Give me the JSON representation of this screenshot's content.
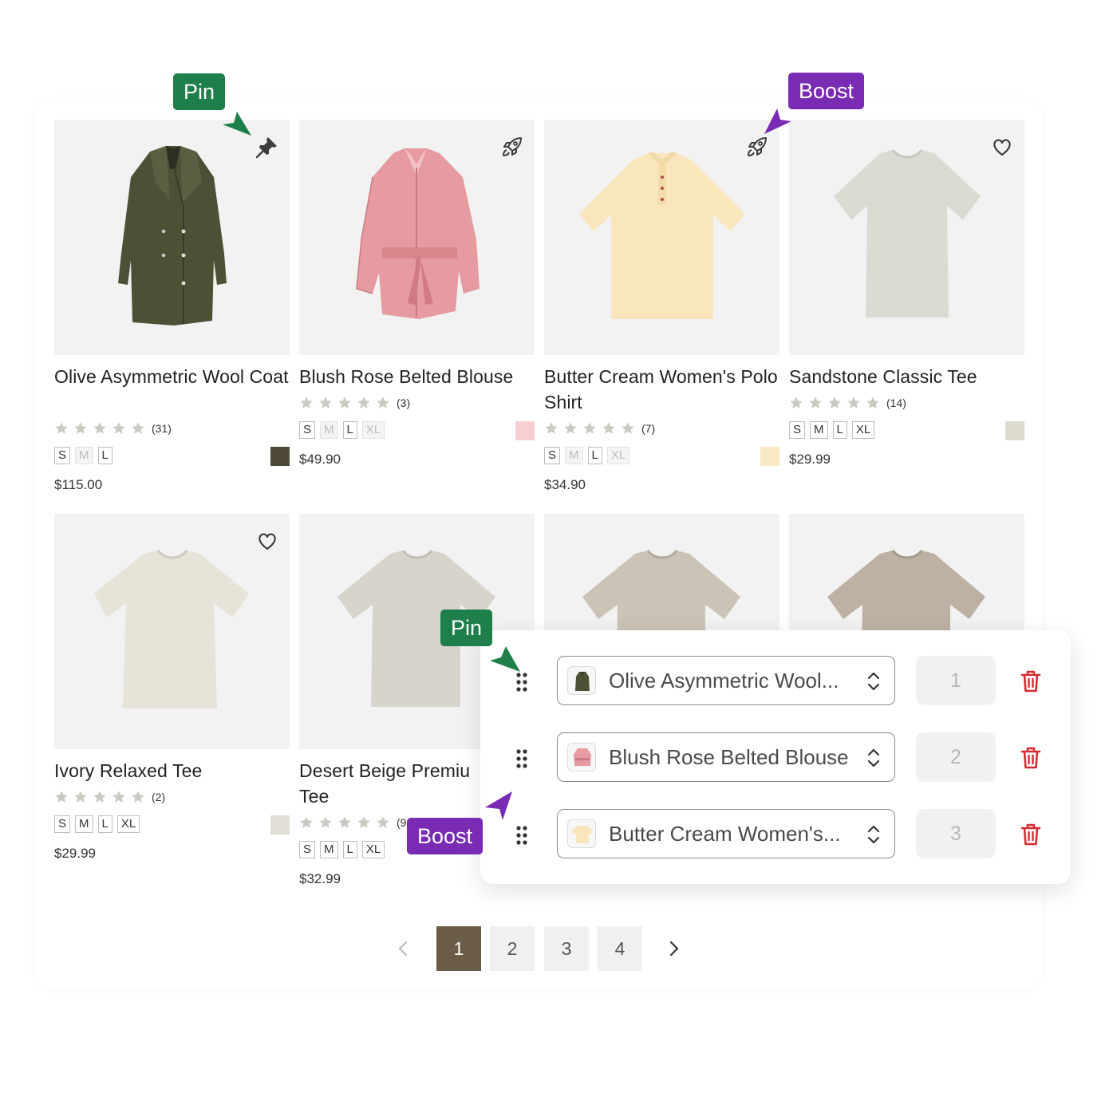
{
  "products": [
    {
      "title": "Olive Asymmetric Wool Coat",
      "reviews": "(31)",
      "sizes": [
        "S",
        "M",
        "L"
      ],
      "dim_sizes": [
        1
      ],
      "swatch": "#4d4838",
      "price": "$115.00",
      "corner_icon": "pin-icon"
    },
    {
      "title": "Blush Rose Belted Blouse",
      "reviews": "(3)",
      "sizes": [
        "S",
        "M",
        "L",
        "XL"
      ],
      "dim_sizes": [
        1,
        3
      ],
      "swatch": "#f7cfd2",
      "price": "$49.90",
      "corner_icon": "rocket-icon"
    },
    {
      "title": "Butter Cream Women's Polo Shirt",
      "reviews": "(7)",
      "sizes": [
        "S",
        "M",
        "L",
        "XL"
      ],
      "dim_sizes": [
        1,
        3
      ],
      "swatch": "#f9e9c2",
      "price": "$34.90",
      "corner_icon": "rocket-icon"
    },
    {
      "title": "Sandstone Classic Tee",
      "reviews": "(14)",
      "sizes": [
        "S",
        "M",
        "L",
        "XL"
      ],
      "dim_sizes": [],
      "swatch": "#dedad0",
      "price": "$29.99",
      "corner_icon": "heart-icon"
    },
    {
      "title": "Ivory Relaxed Tee",
      "reviews": "(2)",
      "sizes": [
        "S",
        "M",
        "L",
        "XL"
      ],
      "dim_sizes": [],
      "swatch": "#e2dfd6",
      "price": "$29.99",
      "corner_icon": "heart-icon"
    },
    {
      "title": "Desert Beige Premiu\nTee",
      "reviews": "(9",
      "sizes": [
        "S",
        "M",
        "L",
        "XL"
      ],
      "dim_sizes": [],
      "price": "$32.99"
    },
    {
      "title": "",
      "corner_icon": ""
    },
    {
      "title": "",
      "corner_icon": ""
    }
  ],
  "tags": {
    "pin": "Pin",
    "boost": "Boost"
  },
  "ranking_panel": {
    "rows": [
      {
        "label": "Olive Asymmetric Wool...",
        "rank": "1"
      },
      {
        "label": "Blush Rose Belted Blouse",
        "rank": "2"
      },
      {
        "label": "Butter Cream Women's...",
        "rank": "3"
      }
    ]
  },
  "pagination": {
    "pages": [
      "1",
      "2",
      "3",
      "4"
    ],
    "current": "1"
  },
  "colors": {
    "pin_green": "#1e7f4a",
    "boost_purple": "#7a2bb3",
    "delete_red": "#d62b32",
    "active_page": "#6a5c45",
    "star": "#c9cbc2"
  }
}
